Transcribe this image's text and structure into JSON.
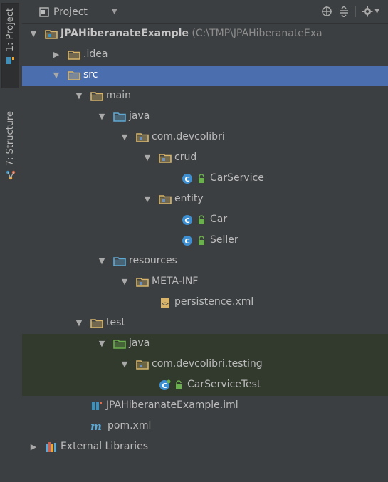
{
  "stripe": {
    "project_tab": "1: Project",
    "structure_tab": "7: Structure"
  },
  "header": {
    "title": "Project"
  },
  "tree": [
    {
      "label": "JPAHiberanateExample",
      "path": "(C:\\TMP\\JPAHiberanateExa",
      "type": "module",
      "depth": 0,
      "arrow": "down",
      "bold": true
    },
    {
      "label": ".idea",
      "type": "folder",
      "depth": 1,
      "arrow": "right"
    },
    {
      "label": "src",
      "type": "folder",
      "depth": 1,
      "arrow": "down",
      "selected": true
    },
    {
      "label": "main",
      "type": "folder",
      "depth": 2,
      "arrow": "down"
    },
    {
      "label": "java",
      "type": "source-folder",
      "depth": 3,
      "arrow": "down"
    },
    {
      "label": "com.devcolibri",
      "type": "package",
      "depth": 4,
      "arrow": "down"
    },
    {
      "label": "crud",
      "type": "package",
      "depth": 5,
      "arrow": "down"
    },
    {
      "label": "CarService",
      "type": "class",
      "depth": 6,
      "arrow": "none"
    },
    {
      "label": "entity",
      "type": "package",
      "depth": 5,
      "arrow": "down"
    },
    {
      "label": "Car",
      "type": "class",
      "depth": 6,
      "arrow": "none"
    },
    {
      "label": "Seller",
      "type": "class",
      "depth": 6,
      "arrow": "none"
    },
    {
      "label": "resources",
      "type": "resources-folder",
      "depth": 3,
      "arrow": "down"
    },
    {
      "label": "META-INF",
      "type": "package",
      "depth": 4,
      "arrow": "down"
    },
    {
      "label": "persistence.xml",
      "type": "xml-file",
      "depth": 5,
      "arrow": "none"
    },
    {
      "label": "test",
      "type": "folder",
      "depth": 2,
      "arrow": "down"
    },
    {
      "label": "java",
      "type": "test-folder",
      "depth": 3,
      "arrow": "down",
      "testbg": true
    },
    {
      "label": "com.devcolibri.testing",
      "type": "package",
      "depth": 4,
      "arrow": "down",
      "testbg": true
    },
    {
      "label": "CarServiceTest",
      "type": "test-class",
      "depth": 5,
      "arrow": "none",
      "testbg": true
    },
    {
      "label": "JPAHiberanateExample.iml",
      "type": "iml-file",
      "depth": 2,
      "arrow": "none"
    },
    {
      "label": "pom.xml",
      "type": "maven-file",
      "depth": 2,
      "arrow": "none"
    },
    {
      "label": "External Libraries",
      "type": "libraries",
      "depth": 0,
      "arrow": "right"
    }
  ],
  "colors": {
    "background": "#3c3f41",
    "selection": "#4b6eaf",
    "test_background": "#323a2e",
    "folder": "#d8b56a",
    "source_folder": "#5fa8d3",
    "test_folder": "#6ab04c",
    "class_icon": "#3d8fd1",
    "lock": "#6ab04c"
  }
}
